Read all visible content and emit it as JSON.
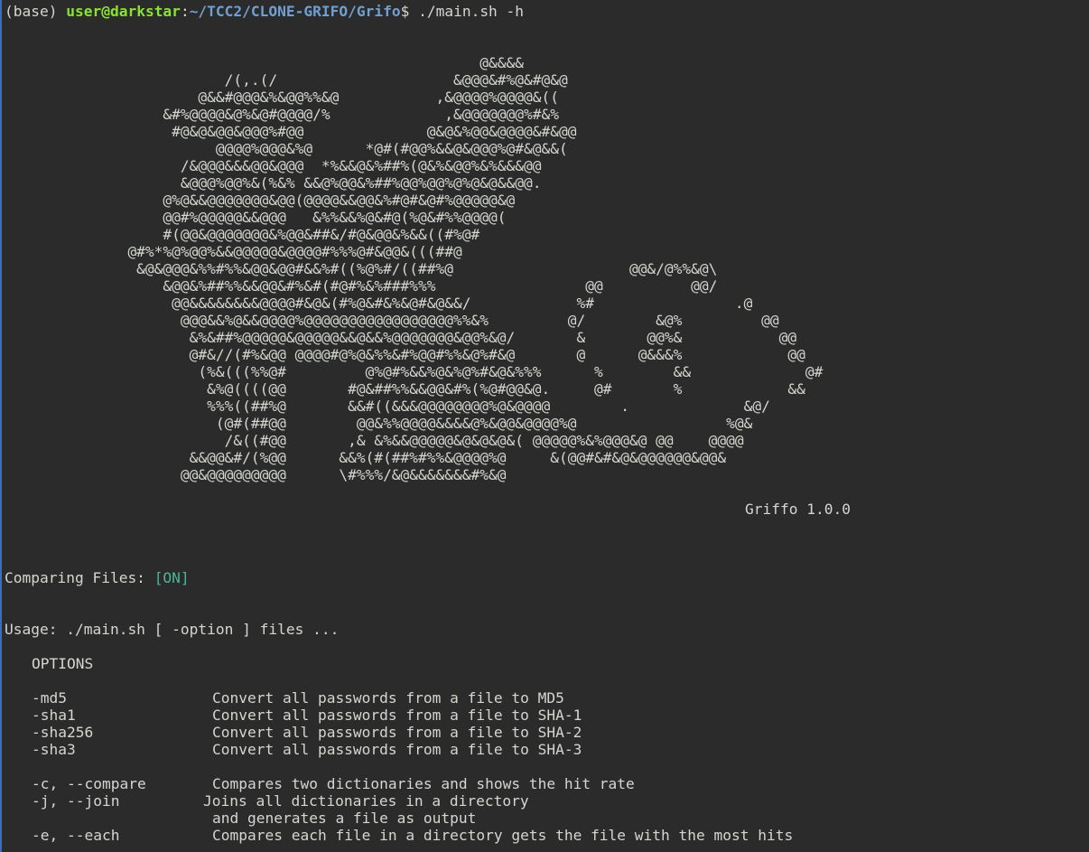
{
  "prompt": {
    "env": "(base) ",
    "user_host": "user@darkstar",
    "colon": ":",
    "path": "~/TCC2/CLONE-GRIFO/Grifo",
    "dollar": "$ ",
    "command": "./main.sh -h"
  },
  "ascii_art": [
    "                                                      @&&&&",
    "                         /(,.(/                    &@@@&#%@&#@&@",
    "                      @&&#@@@&%&@@%%&@           ,&@@@@%@@@@&((",
    "                  &#%@@@@&@%&@#@@@@/%             ,&@@@@@@@%#&%",
    "                   #@&@&@@&@@@%#@@              @&@&%@@&@@@@&#&@@",
    "                        @@@@%@@@&%@      *@#(#@@%&&@&@@@%@#&@&&(",
    "                    /&@@@&&&@@&@@@  *%&&@&%##%(@&%&@@%&%&&&@@",
    "                    &@@@%@@%&(%&% &&@%@@&%##%@@%@@%@%@&@&&@@.",
    "                  @%@&&@@@@@@@&@@(@@@@&&@@&%#@#&@#%@@@@@&@",
    "                  @@#%@@@@@&&@@@   &%%&&%@&#@(%@&#%%@@@@(",
    "                  #(@@&@@@@@@@&%@@&##&/#@&@@&%&&((#%@#",
    "              @#%*%@%@@%&&@@@@@&@@@@#%%%@#&@@&(((##@",
    "               &@&@@@&%%#%%&@@&@@#&&%#((%@%#/((##%@                    @@&/@%%&@\\",
    "                  &@@&%##%%&&@@&#%&#(#@#%&%###%%%                 @@          @@/",
    "                   @@&&&&&&&&@@@@#&@&(#%@&#&%&@#&@&&/            %#                .@",
    "                    @@@&&%@&&@@@@%@@@@@@@@@@@@@@@@@%%&%         @/        &@%         @@",
    "                     &%&##%@@@@@&@@@@@&&@&&%@@@@@@@&@@%&@/       &       @@%&           @@",
    "                     @#&//(#%&@@ @@@@#@%@&%%&#%@@#%%&@%#&@       @      @&&&%            @@",
    "                      (%&(((%%@#         @%@#%&&%@&%@%#&@&%%%      %        &&             @#",
    "                       &%@((((@@       #@&##%%&&@@&#%(%@#@@&@.     @#       %            &&",
    "                       %%%((##%@       &&#((&&&@@@@@@@@%@&@@@@        .             &@/",
    "                        (@#(##@@        @@&%%@@@@&&&&@%&@@&@@@@%@                 %@&",
    "                         /&((#@@       ,& &%&&@@@@@&@&@&@&( @@@@@%&%@@@&@ @@    @@@@",
    "                     &&@@&#/(%@@      &&%(#(##%#%%&@@@@%@     &(@@#&#&@&@@@@@@&@@&",
    "                    @@&@@@@@@@@@      \\#%%%/&@&&&&&&&#%&@"
  ],
  "version": "Griffo 1.0.0",
  "comparing": {
    "label": "Comparing Files: ",
    "status": "[ON]"
  },
  "usage": "Usage: ./main.sh [ -option ] files ...",
  "options_header": "OPTIONS",
  "options": [
    {
      "flag": "-md5",
      "desc": "Convert all passwords from a file to MD5"
    },
    {
      "flag": "-sha1",
      "desc": "Convert all passwords from a file to SHA-1"
    },
    {
      "flag": "-sha256",
      "desc": "Convert all passwords from a file to SHA-2"
    },
    {
      "flag": "-sha3",
      "desc": "Convert all passwords from a file to SHA-3"
    },
    {
      "flag": "-c, --compare",
      "desc": "Compares two dictionaries and shows the hit rate"
    },
    {
      "flag": "-j, --join",
      "desc": "Joins all dictionaries in a directory"
    },
    {
      "flag": "",
      "desc": "and generates a file as output"
    },
    {
      "flag": "-e, --each",
      "desc": "Compares each file in a directory gets the file with the most hits"
    }
  ]
}
